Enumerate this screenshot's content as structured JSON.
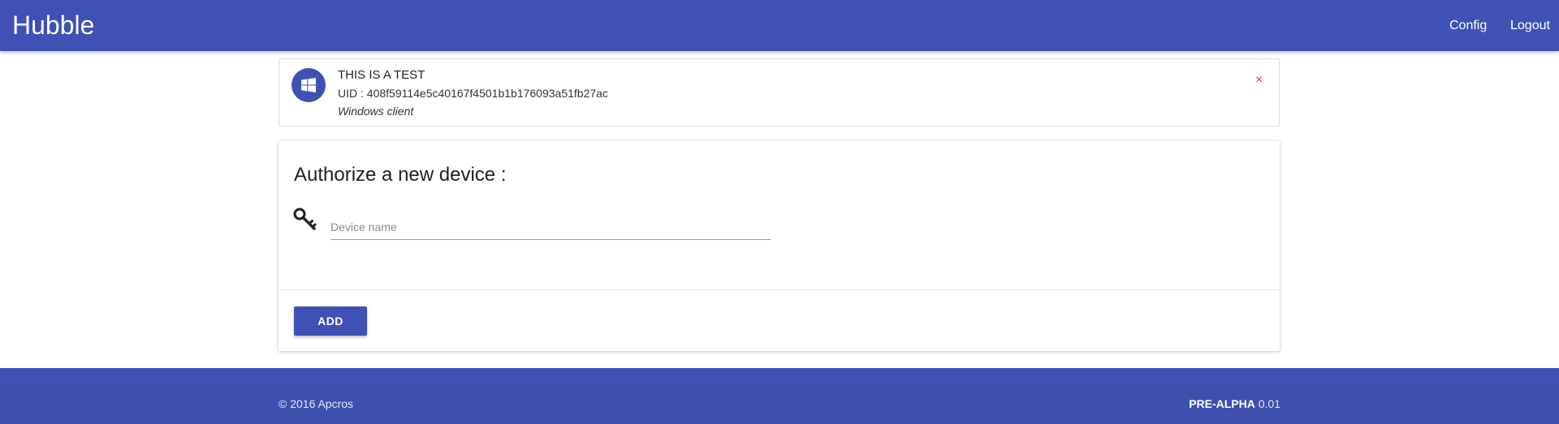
{
  "header": {
    "brand": "Hubble",
    "nav": {
      "config": "Config",
      "logout": "Logout"
    }
  },
  "device": {
    "icon": "windows-icon",
    "name": "THIS IS A TEST",
    "uid": "UID : 408f59114e5c40167f4501b1b176093a51fb27ac",
    "type": "Windows client",
    "remove_icon": "close-icon",
    "remove_label": "×"
  },
  "authorize": {
    "title": "Authorize a new device :",
    "icon": "key-icon",
    "input": {
      "placeholder": "Device name",
      "value": ""
    },
    "add_label": "ADD"
  },
  "footer": {
    "copyright": "© 2016 Apcros",
    "version_label": "PRE-ALPHA",
    "version_number": "0.01"
  },
  "colors": {
    "primary": "#3f51b5",
    "remove": "#e53935",
    "footer": "#3d50ae"
  }
}
